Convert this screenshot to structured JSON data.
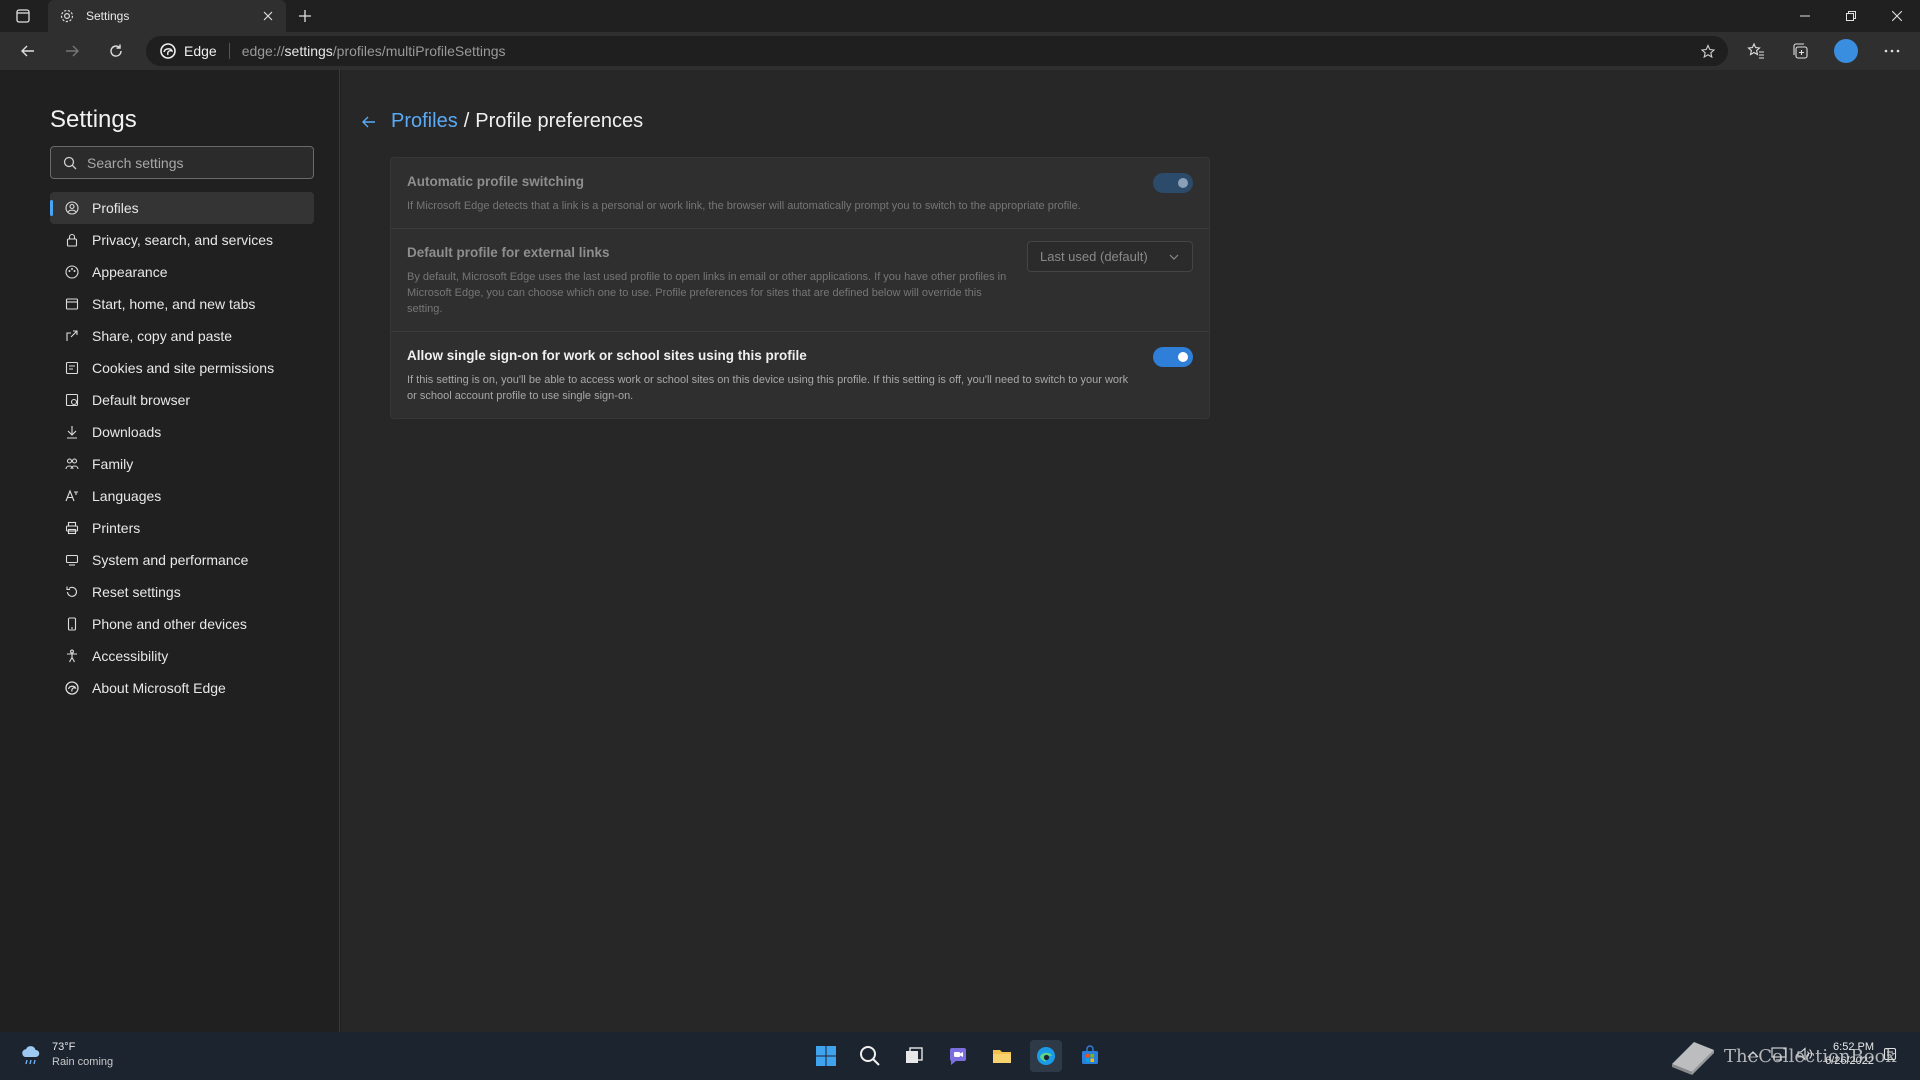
{
  "browser": {
    "tab_title": "Settings",
    "site_name": "Edge",
    "url_prefix": "edge://",
    "url_highlight": "settings",
    "url_rest": "/profiles/multiProfileSettings"
  },
  "sidebar": {
    "title": "Settings",
    "search_placeholder": "Search settings",
    "items": [
      {
        "label": "Profiles",
        "icon": "profile-icon"
      },
      {
        "label": "Privacy, search, and services",
        "icon": "lock-icon"
      },
      {
        "label": "Appearance",
        "icon": "appearance-icon"
      },
      {
        "label": "Start, home, and new tabs",
        "icon": "home-tabs-icon"
      },
      {
        "label": "Share, copy and paste",
        "icon": "share-icon"
      },
      {
        "label": "Cookies and site permissions",
        "icon": "cookies-icon"
      },
      {
        "label": "Default browser",
        "icon": "browser-icon"
      },
      {
        "label": "Downloads",
        "icon": "download-icon"
      },
      {
        "label": "Family",
        "icon": "family-icon"
      },
      {
        "label": "Languages",
        "icon": "languages-icon"
      },
      {
        "label": "Printers",
        "icon": "printer-icon"
      },
      {
        "label": "System and performance",
        "icon": "system-icon"
      },
      {
        "label": "Reset settings",
        "icon": "reset-icon"
      },
      {
        "label": "Phone and other devices",
        "icon": "phone-icon"
      },
      {
        "label": "Accessibility",
        "icon": "accessibility-icon"
      },
      {
        "label": "About Microsoft Edge",
        "icon": "edge-icon"
      }
    ]
  },
  "main": {
    "breadcrumb_link": "Profiles",
    "breadcrumb_sep": "/",
    "breadcrumb_current": "Profile preferences",
    "settings": [
      {
        "title": "Automatic profile switching",
        "desc": "If Microsoft Edge detects that a link is a personal or work link, the browser will automatically prompt you to switch to the appropriate profile.",
        "state": "on",
        "enabled": false
      },
      {
        "title": "Default profile for external links",
        "desc": "By default, Microsoft Edge uses the last used profile to open links in email or other applications. If you have other profiles in Microsoft Edge, you can choose which one to use. Profile preferences for sites that are defined below will override this setting.",
        "select_value": "Last used (default)",
        "enabled": false
      },
      {
        "title": "Allow single sign-on for work or school sites using this profile",
        "desc": "If this setting is on, you'll be able to access work or school sites on this device using this profile. If this setting is off, you'll need to switch to your work or school account profile to use single sign-on.",
        "state": "on",
        "enabled": true
      }
    ]
  },
  "taskbar": {
    "temperature": "73°F",
    "weather_text": "Rain coming",
    "time": "6:52 PM",
    "date": "6/26/2022",
    "watermark": "TheCollectionBook"
  },
  "colors": {
    "accent": "#2f7fd8",
    "link": "#5aaaf5"
  }
}
